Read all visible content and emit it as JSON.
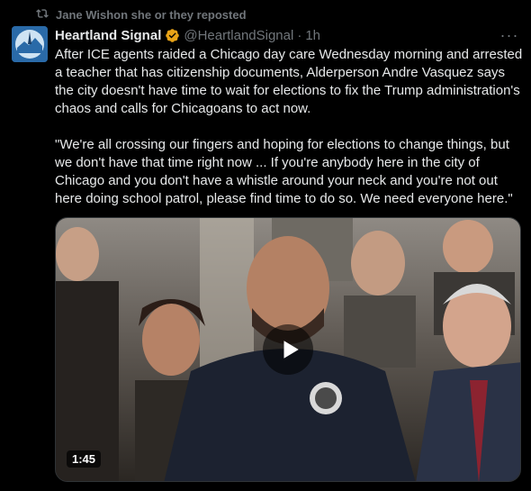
{
  "repost": {
    "icon": "repost-icon",
    "text": "Jane Wishon she or they reposted"
  },
  "tweet": {
    "author_name": "Heartland Signal",
    "verified_icon": "verified-badge-icon",
    "verified_color": "#e8a317",
    "handle": "@HeartlandSignal",
    "separator": "·",
    "time": "1h",
    "more_icon": "more-options-icon",
    "more_label": "···",
    "paragraph_1": "After ICE agents raided a Chicago day care Wednesday morning and arrested a teacher that has citizenship documents, Alderperson Andre Vasquez says the city doesn't have time to wait for elections to fix the Trump administration's chaos and calls for Chicagoans to act now.",
    "paragraph_2": "\"We're all crossing our fingers and hoping for elections to change things, but we don't have that time right now ... If you're anybody here in the city of Chicago and you don't have a whistle around your neck and you're not out here doing school patrol, please find time to do so. We need everyone here.\""
  },
  "video": {
    "duration": "1:45",
    "play_icon": "play-icon"
  },
  "colors": {
    "background": "#000000",
    "text": "#e7e9ea",
    "muted": "#71767b",
    "border": "#2f3336"
  }
}
